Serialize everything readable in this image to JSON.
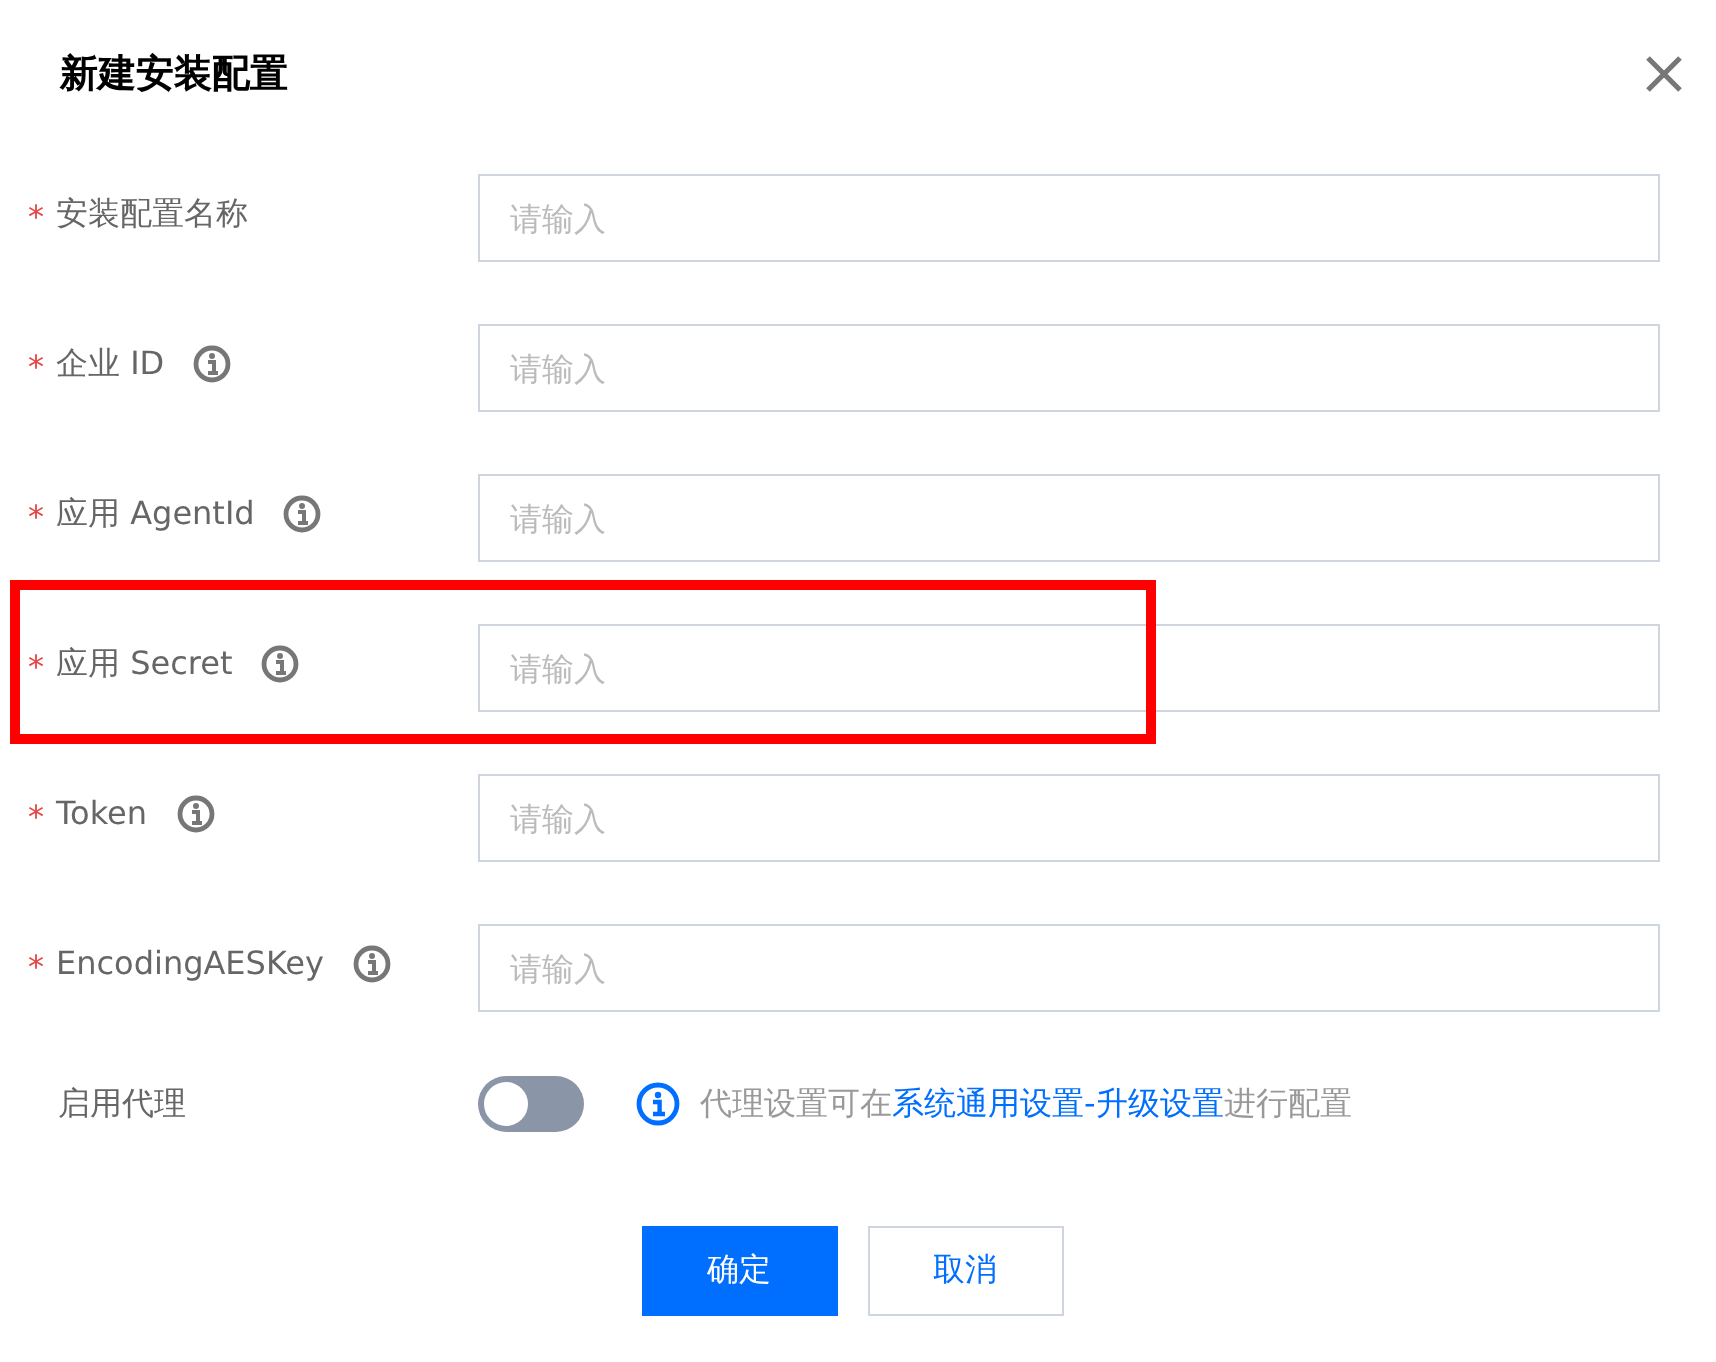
{
  "dialog": {
    "title": "新建安装配置"
  },
  "fields": [
    {
      "label": "安装配置名称",
      "marker": "*",
      "info": false,
      "placeholder": "请输入",
      "highlighted": false
    },
    {
      "label": "企业 ID",
      "marker": "*",
      "info": true,
      "placeholder": "请输入",
      "highlighted": false
    },
    {
      "label": "应用 AgentId",
      "marker": "*",
      "info": true,
      "placeholder": "请输入",
      "highlighted": false
    },
    {
      "label": "应用 Secret",
      "marker": "*",
      "info": true,
      "placeholder": "请输入",
      "highlighted": true
    },
    {
      "label": "Token",
      "marker": "*",
      "info": true,
      "placeholder": "请输入",
      "highlighted": false
    },
    {
      "label": "EncodingAESKey",
      "marker": "*",
      "info": true,
      "placeholder": "请输入",
      "highlighted": false
    }
  ],
  "proxy": {
    "label": "启用代理",
    "on": false,
    "hint_before": "代理设置可在",
    "hint_link": "系统通用设置-升级设置",
    "hint_after": "进行配置"
  },
  "buttons": [
    {
      "label": "确定",
      "kind": "primary"
    },
    {
      "label": "取消",
      "kind": "secondary"
    }
  ]
}
